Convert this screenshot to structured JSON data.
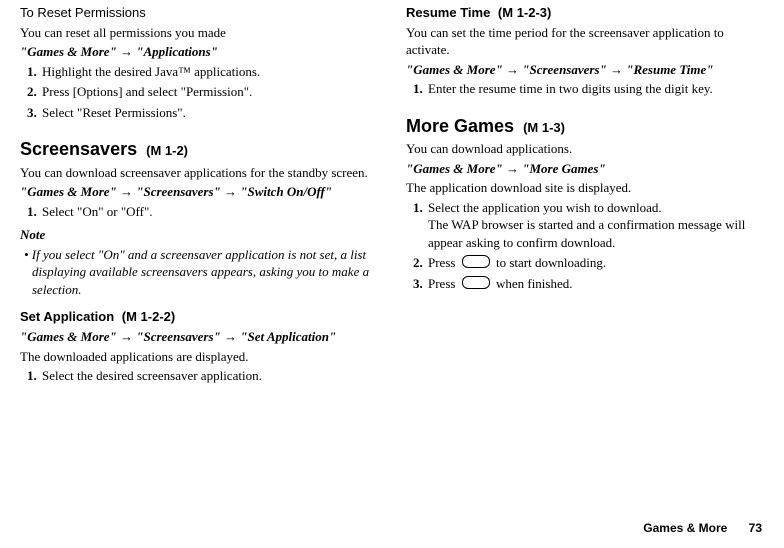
{
  "left": {
    "resetTitle": "To Reset Permissions",
    "resetIntro": "You can reset all permissions you made",
    "resetPath": "\"Games & More\" → \"Applications\"",
    "resetSteps": [
      "Highlight the desired Java™ applications.",
      "Press [Options] and select \"Permission\".",
      "Select \"Reset Permissions\"."
    ],
    "ssTitle": "Screensavers",
    "ssCode": "(M 1-2)",
    "ssIntro": "You can download screensaver applications for the standby screen.",
    "ssPath": "\"Games & More\" → \"Screensavers\" → \"Switch On/Off\"",
    "ssSteps": [
      "Select \"On\" or \"Off\"."
    ],
    "noteLabel": "Note",
    "noteBody": "• If you select \"On\" and a screensaver application is not set, a list displaying available screensavers appears, asking you to make a selection.",
    "setTitle": "Set Application",
    "setCode": "(M 1-2-2)",
    "setPath": "\"Games & More\" → \"Screensavers\" → \"Set Application\"",
    "setIntro": "The downloaded applications are displayed.",
    "setSteps": [
      "Select the desired screensaver application."
    ]
  },
  "right": {
    "resumeTitle": "Resume Time",
    "resumeCode": "(M 1-2-3)",
    "resumeIntro": "You can set the time period for the screensaver application to activate.",
    "resumePath": "\"Games & More\" → \"Screensavers\" → \"Resume Time\"",
    "resumeSteps": [
      "Enter the resume time in two digits using the digit key."
    ],
    "moreTitle": "More Games",
    "moreCode": "(M 1-3)",
    "moreIntro": "You can download applications.",
    "morePath": "\"Games & More\" → \"More Games\"",
    "moreIntro2": "The application download site is displayed.",
    "moreStep1a": "Select the application you wish to download.",
    "moreStep1b": "The WAP browser is started and a confirmation message will appear asking to confirm download.",
    "moreStep2a": "Press ",
    "moreStep2b": " to start downloading.",
    "moreStep3a": "Press ",
    "moreStep3b": " when finished."
  },
  "footer": {
    "section": "Games & More",
    "page": "73"
  }
}
